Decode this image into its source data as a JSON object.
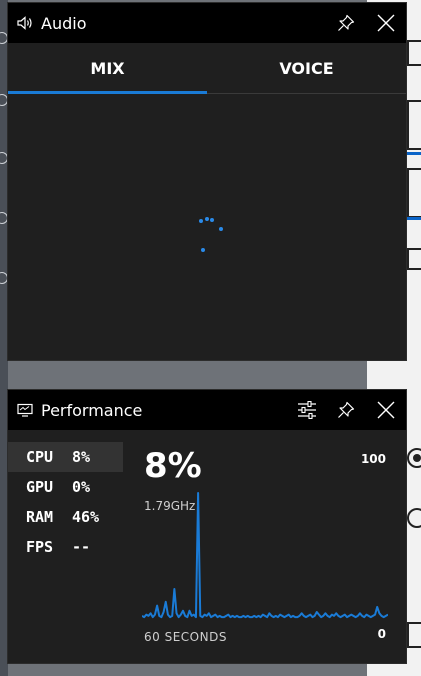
{
  "audio_widget": {
    "title": "Audio",
    "tabs": [
      {
        "label": "MIX",
        "active": true
      },
      {
        "label": "VOICE",
        "active": false
      }
    ],
    "icons": {
      "title": "speaker-icon",
      "pin": "pin-icon",
      "close": "close-icon"
    }
  },
  "performance_widget": {
    "title": "Performance",
    "metrics": [
      {
        "name": "CPU",
        "value": "8%",
        "active": true
      },
      {
        "name": "GPU",
        "value": "0%",
        "active": false
      },
      {
        "name": "RAM",
        "value": "46%",
        "active": false
      },
      {
        "name": "FPS",
        "value": "--",
        "active": false
      }
    ],
    "current_percent": "8%",
    "frequency": "1.79GHz",
    "graph_max_label": "100",
    "graph_min_label": "0",
    "duration_label": "60 SECONDS",
    "icons": {
      "title": "performance-monitor-icon",
      "options": "sliders-icon",
      "pin": "pin-icon",
      "close": "close-icon"
    }
  },
  "chart_data": {
    "type": "line",
    "ylim": [
      0,
      100
    ],
    "values": [
      4,
      3,
      5,
      4,
      6,
      3,
      5,
      12,
      4,
      3,
      7,
      15,
      5,
      3,
      4,
      25,
      6,
      3,
      5,
      8,
      4,
      3,
      8,
      4,
      5,
      3,
      100,
      4,
      3,
      5,
      4,
      6,
      3,
      4,
      5,
      3,
      4,
      3,
      3,
      4,
      5,
      3,
      4,
      3,
      4,
      3,
      3,
      4,
      3,
      4,
      3,
      3,
      4,
      3,
      4,
      3,
      5,
      4,
      3,
      6,
      4,
      3,
      4,
      3,
      5,
      4,
      3,
      4,
      5,
      3,
      4,
      3,
      3,
      4,
      6,
      4,
      3,
      4,
      5,
      3,
      4,
      7,
      5,
      3,
      4,
      6,
      4,
      3,
      5,
      4,
      6,
      4,
      3,
      4,
      5,
      3,
      4,
      5,
      4,
      3,
      4,
      6,
      4,
      3,
      5,
      4,
      3,
      4,
      5,
      11,
      6,
      4,
      3,
      4,
      5
    ],
    "colors": {
      "line": "#1a7bd6",
      "accent": "#1a7bd6"
    }
  }
}
